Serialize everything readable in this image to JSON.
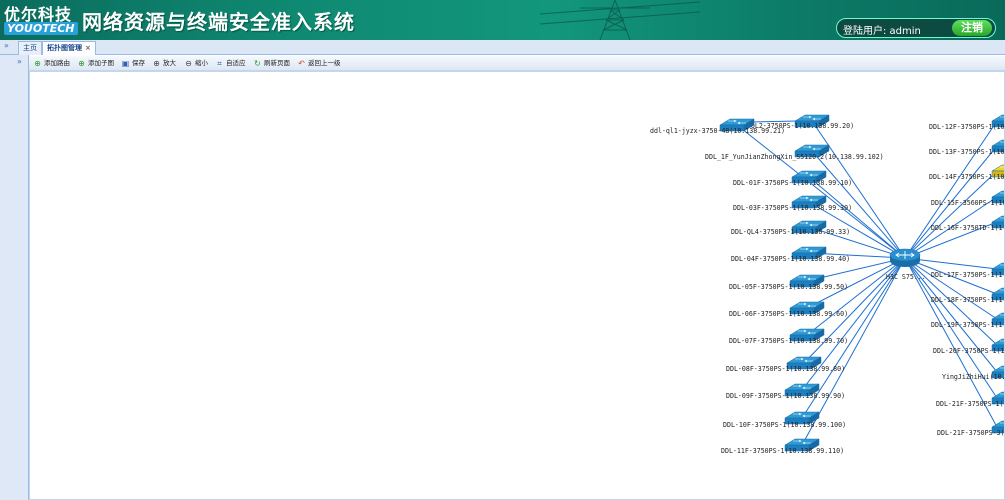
{
  "header": {
    "logo_cn": "优尔科技",
    "logo_en": "YOUOTECH",
    "system_title": "网络资源与终端安全准入系统",
    "user_label": "登陆用户: admin",
    "logout_label": "注销"
  },
  "tabs": [
    {
      "label": "主页"
    },
    {
      "label": "拓扑图管理"
    }
  ],
  "toolbar": {
    "add_path": "添加路由",
    "add_subgraph": "添加子图",
    "save": "保存",
    "zoom_in": "放大",
    "zoom_out": "缩小",
    "fit": "自适应",
    "refresh": "刷新页面",
    "back": "返回上一级"
  },
  "colors": {
    "link": "#1f6fd1",
    "switch": "#2e9bd6",
    "switch_alert": "#f2d52a",
    "router": "#2a8fd0"
  },
  "topology": {
    "core": {
      "label": "H3C S75..."
    },
    "left_nodes": [
      {
        "label": "DDL-QL2-3750PS-1(10.138.99.20)"
      },
      {
        "label": "ddl-ql1-jyzx-3750-48(10.138.99.21)"
      },
      {
        "label": "DDL_1F_YunJianZhongXin_S5120-2(10.138.99.102)"
      },
      {
        "label": "DDL-01F-3750PS-1(10.138.99.10)"
      },
      {
        "label": "DDL-03F-3750PS-1(10.138.99.30)"
      },
      {
        "label": "DDL-QL4-3750PS-1(10.138.99.33)"
      },
      {
        "label": "DDL-04F-3750PS-1(10.138.99.40)"
      },
      {
        "label": "DDL-05F-3750PS-1(10.138.99.50)"
      },
      {
        "label": "DDL-06F-3750PS-1(10.138.99.60)"
      },
      {
        "label": "DDL-07F-3750PS-1(10.138.99.70)"
      },
      {
        "label": "DDL-08F-3750PS-1(10.138.99.80)"
      },
      {
        "label": "DDL-09F-3750PS-1(10.138.99.90)"
      },
      {
        "label": "DDL-10F-3750PS-1(10.138.99.100)"
      },
      {
        "label": "DDL-11F-3750PS-1(10.138.99.110)"
      }
    ],
    "right_nodes": [
      {
        "label": "DDL-12F-3750PS-1(10",
        "alert": false
      },
      {
        "label": "DDL-13F-3750PS-1(10",
        "alert": false
      },
      {
        "label": "DDL-14F-3750PS-1(10",
        "alert": true
      },
      {
        "label": "DDL-15F-3560PS-1(10",
        "alert": false
      },
      {
        "label": "DDL-16F-3750TD-1(1",
        "alert": false
      },
      {
        "label": "DDL-17F-3750PS-1(1",
        "alert": false
      },
      {
        "label": "DDL-18F-3750PS-1(1",
        "alert": false
      },
      {
        "label": "DDL-19F-3750PS-1(1",
        "alert": false
      },
      {
        "label": "DDL-20F-3750PS-1(1",
        "alert": false
      },
      {
        "label": "YingJiZhiHui(10.",
        "alert": false
      },
      {
        "label": "DDL-21F-3750PS-1(",
        "alert": false
      },
      {
        "label": "DDL-21F-3750PS-3(",
        "alert": false
      }
    ]
  }
}
